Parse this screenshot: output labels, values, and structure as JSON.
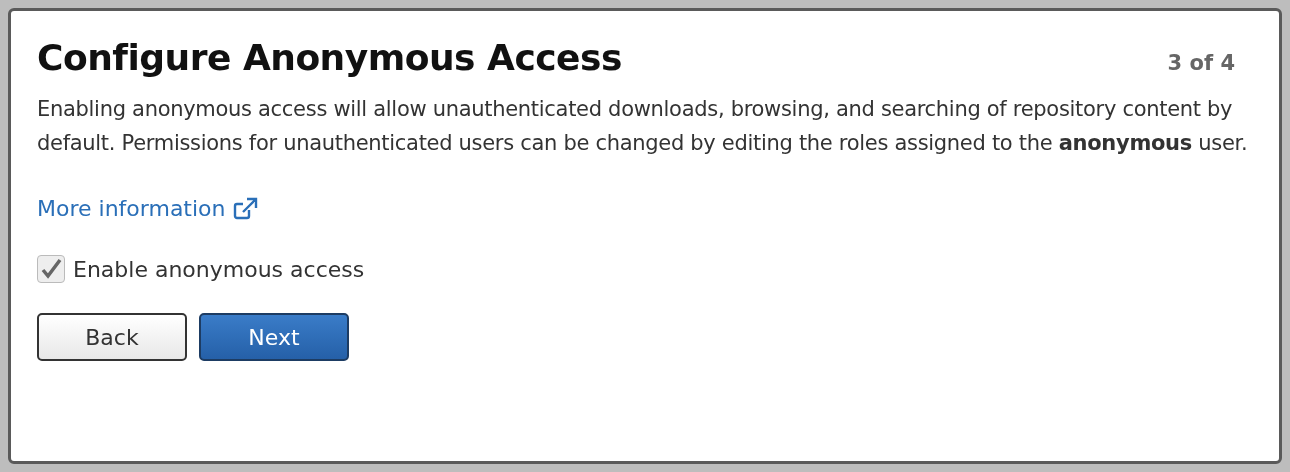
{
  "dialog": {
    "title": "Configure Anonymous Access",
    "step": "3 of 4",
    "description": "Enabling anonymous access will allow unauthenticated downloads, browsing, and searching of repository content by default. Permissions for unauthenticated users can be changed by editing the roles assigned to the **anonymous** user.",
    "link": "More information",
    "checkbox": {
      "label": "Enable anonymous access",
      "checked": true
    },
    "buttons": [
      {
        "label": "Back",
        "kind": "secondary"
      },
      {
        "label": "Next",
        "kind": "primary"
      }
    ]
  }
}
